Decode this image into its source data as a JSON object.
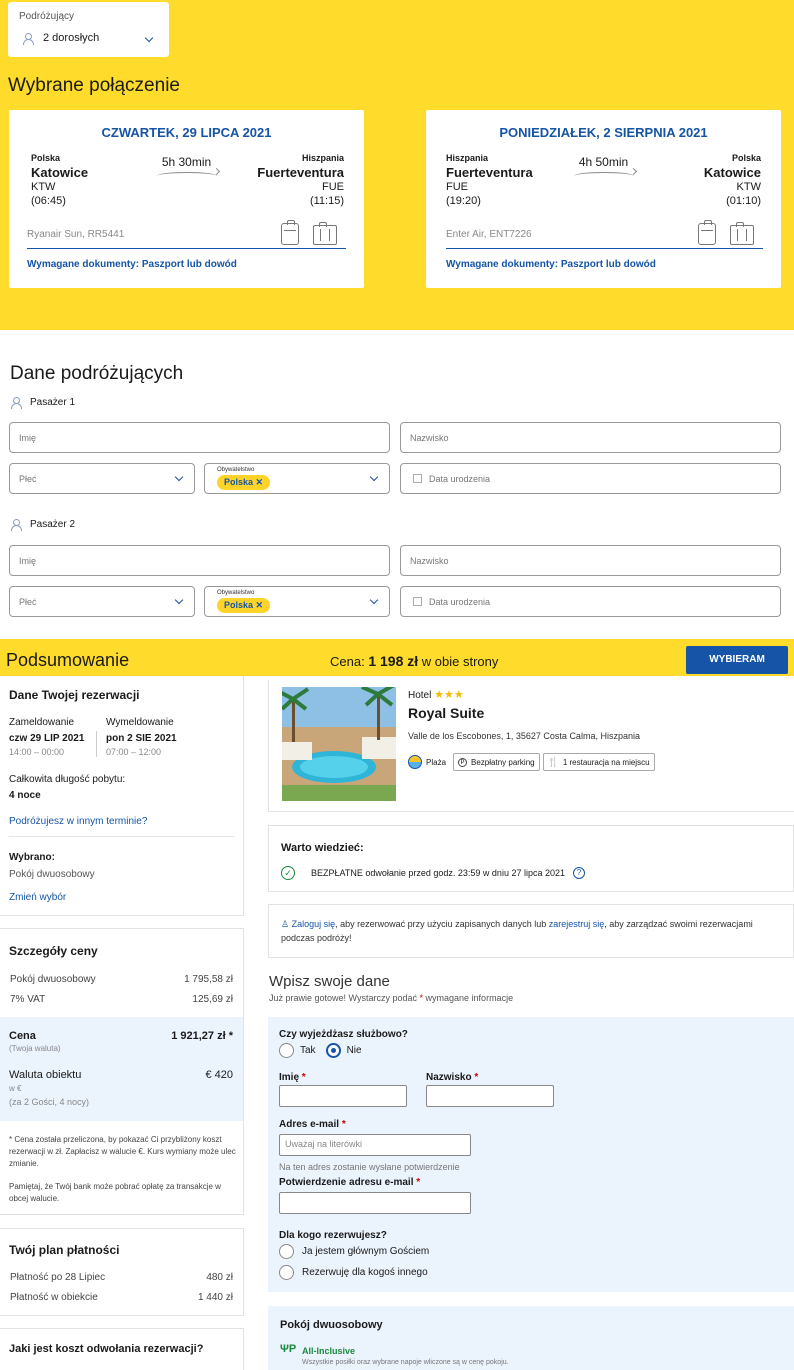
{
  "travelers": {
    "label": "Podróżujący",
    "value": "2 dorosłych"
  },
  "selected_connection": {
    "title": "Wybrane połączenie",
    "outbound": {
      "date": "CZWARTEK, 29 LIPCA 2021",
      "from_country": "Polska",
      "from_city": "Katowice",
      "from_code": "KTW",
      "from_time": "(06:45)",
      "duration": "5h 30min",
      "to_country": "Hiszpania",
      "to_city": "Fuerteventura",
      "to_code": "FUE",
      "to_time": "(11:15)",
      "carrier": "Ryanair Sun, RR5441",
      "docs": "Wymagane dokumenty: Paszport lub dowód"
    },
    "return": {
      "date": "PONIEDZIAŁEK, 2 SIERPNIA 2021",
      "from_country": "Hiszpania",
      "from_city": "Fuerteventura",
      "from_code": "FUE",
      "from_time": "(19:20)",
      "duration": "4h 50min",
      "to_country": "Polska",
      "to_city": "Katowice",
      "to_code": "KTW",
      "to_time": "(01:10)",
      "carrier": "Enter Air, ENT7226",
      "docs": "Wymagane dokumenty: Paszport lub dowód"
    }
  },
  "passengers": {
    "title": "Dane podróżujących",
    "list": [
      {
        "label": "Pasażer 1"
      },
      {
        "label": "Pasażer 2"
      }
    ],
    "placeholders": {
      "first_name": "Imię",
      "last_name": "Nazwisko",
      "gender": "Płeć",
      "citizenship_label": "Obywatelstwo",
      "citizenship_value": "Polska",
      "birth_date": "Data urodzenia"
    }
  },
  "summary": {
    "title": "Podsumowanie",
    "price_prefix": "Cena:",
    "price": "1 198 zł",
    "price_suffix": "w obie strony",
    "cta": "WYBIERAM"
  },
  "reservation": {
    "title": "Dane Twojej rezerwacji",
    "checkin_label": "Zameldowanie",
    "checkin_date": "czw 29 LIP 2021",
    "checkin_time": "14:00 – 00:00",
    "checkout_label": "Wymeldowanie",
    "checkout_date": "pon 2 SIE 2021",
    "checkout_time": "07:00 – 12:00",
    "length_label": "Całkowita długość pobytu:",
    "length_value": "4 noce",
    "other_dates_link": "Podróżujesz w innym terminie?",
    "chosen_label": "Wybrano:",
    "chosen_value": "Pokój dwuosobowy",
    "change_link": "Zmień wybór"
  },
  "price_details": {
    "title": "Szczegóły ceny",
    "rows": [
      {
        "label": "Pokój dwuosobowy",
        "value": "1 795,58 zł"
      },
      {
        "label": "7% VAT",
        "value": "125,69 zł"
      }
    ],
    "total_label": "Cena",
    "total_sub": "(Twoja waluta)",
    "total_value": "1 921,27 zł *",
    "obj_label": "Waluta obiektu",
    "obj_sub1": "w €",
    "obj_sub2": "(za 2 Gości,  4 nocy)",
    "obj_value": "€ 420",
    "note1": "* Cena została przeliczona, by pokazać Ci przybliżony koszt rezerwacji w zł. Zapłacisz w walucie €. Kurs wymiany może ulec zmianie.",
    "note2": "Pamiętaj, że Twój bank może pobrać opłatę za transakcje w obcej walucie."
  },
  "payment_plan": {
    "title": "Twój plan płatności",
    "rows": [
      {
        "label": "Płatność po 28 Lipiec",
        "value": "480 zł"
      },
      {
        "label": "Płatność w obiekcie",
        "value": "1 440 zł"
      }
    ]
  },
  "cancellation": {
    "title": "Jaki jest koszt odwołania rezerwacji?"
  },
  "hotel": {
    "type_label": "Hotel",
    "stars": "★★★",
    "name": "Royal Suite",
    "address": "Valle de los Escobones, 1, 35627 Costa Calma, Hiszpania",
    "facilities": [
      "Plaża",
      "Bezpłatny parking",
      "1 restauracja na miejscu"
    ]
  },
  "worth_knowing": {
    "title": "Warto wiedzieć:",
    "text": "BEZPŁATNE odwołanie przed godz. 23:59 w dniu 27 lipca 2021"
  },
  "login_notice": {
    "login_link": "Zaloguj się",
    "text1": ", aby rezerwować przy użyciu zapisanych danych lub ",
    "register_link": "zarejestruj się",
    "text2": ", aby zarządzać swoimi rezerwacjami podczas podróży!"
  },
  "your_data": {
    "title": "Wpisz swoje dane",
    "subtitle_pre": "Już prawie gotowe! Wystarczy podać",
    "subtitle_req": "*",
    "subtitle_post": "wymagane informacje",
    "business_q": "Czy wyjeżdżasz służbowo?",
    "yes": "Tak",
    "no": "Nie",
    "first_name": "Imię",
    "last_name": "Nazwisko",
    "email_label": "Adres e-mail",
    "email_placeholder": "Uważaj na literówki",
    "email_hint": "Na ten adres zostanie wysłane potwierdzenie",
    "email_confirm_label": "Potwierdzenie adresu e-mail",
    "for_whom_q": "Dla kogo rezerwujesz?",
    "opt_self": "Ja jestem głównym Gościem",
    "opt_other": "Rezerwuję dla kogoś innego",
    "req": "*"
  },
  "room": {
    "title": "Pokój dwuosobowy",
    "board": "All-Inclusive",
    "board_desc": "Wszystkie posiłki oraz wybrane napoje wliczone są w cenę pokoju."
  },
  "colors": {
    "yellow": "#ffdc2b",
    "blue": "#1554a6",
    "green": "#1a8a3a",
    "light_blue": "#ebf3fd"
  }
}
